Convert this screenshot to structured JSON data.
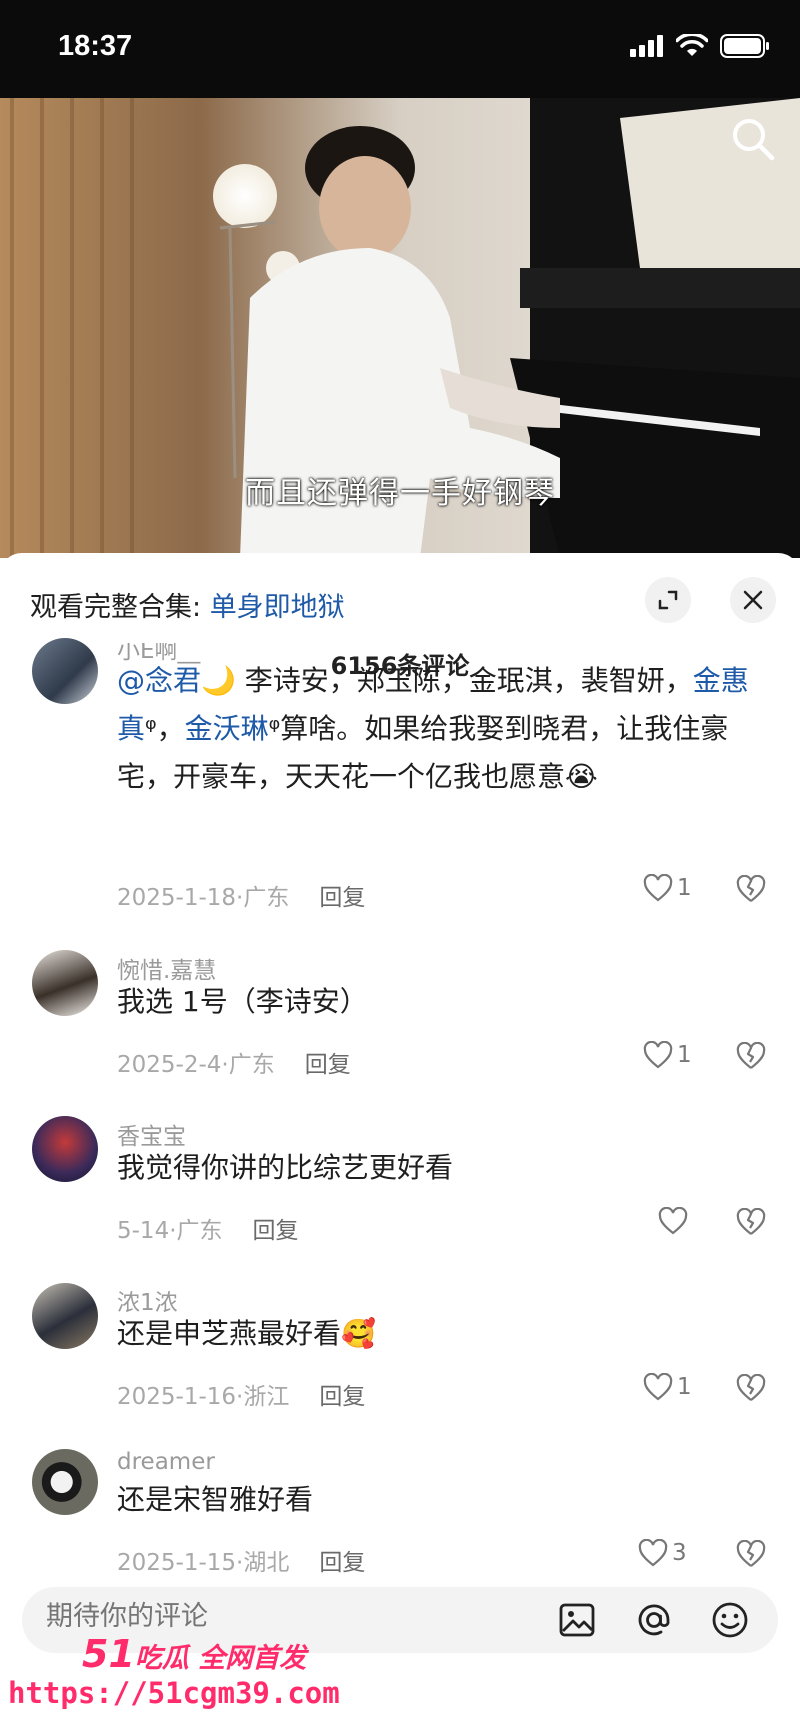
{
  "status_bar": {
    "time": "18:37"
  },
  "video": {
    "subtitle": "而且还弹得一手好钢琴"
  },
  "panel": {
    "collection_prefix": "观看完整合集: ",
    "collection_name": "单身即地狱",
    "comment_count": "6156条评论"
  },
  "comments": [
    {
      "username": "小E啊__",
      "text_parts": [
        "@念君",
        "🌙 李诗安，郑玉陈，金珉淇，裴智妍，",
        "金惠真",
        "ᵠ，",
        "金沃琳",
        "ᵠ算啥。如果给我娶到晓君，让我住豪宅，开豪车，天天花一个亿我也愿意😭"
      ],
      "date": "2025-1-18",
      "location": "广东",
      "reply": "回复",
      "likes": "1"
    },
    {
      "username": "惋惜.嘉慧",
      "text": "我选 1号（李诗安）",
      "date": "2025-2-4",
      "location": "广东",
      "reply": "回复",
      "likes": "1"
    },
    {
      "username": "香宝宝",
      "text": "我觉得你讲的比综艺更好看",
      "date": "5-14",
      "location": "广东",
      "reply": "回复",
      "likes": ""
    },
    {
      "username": "浓1浓",
      "text": "还是申芝燕最好看🥰",
      "date": "2025-1-16",
      "location": "浙江",
      "reply": "回复",
      "likes": "1"
    },
    {
      "username": "dreamer",
      "text": "还是宋智雅好看",
      "date": "2025-1-15",
      "location": "湖北",
      "reply": "回复",
      "likes": "3"
    }
  ],
  "input": {
    "placeholder": "期待你的评论"
  },
  "watermark": {
    "brand_num": "51",
    "brand_text": "吃瓜 全网首发",
    "url": "https://51cgm39.com"
  },
  "colors": {
    "link": "#1e5aa8",
    "watermark": "#ff2b6a"
  }
}
